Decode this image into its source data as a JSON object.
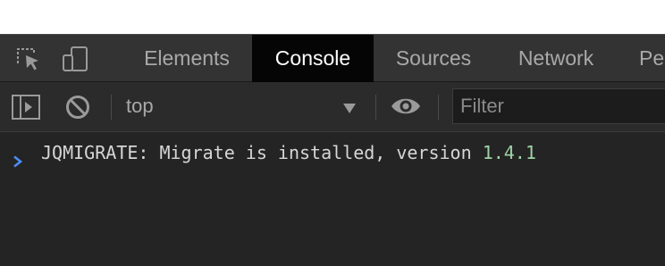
{
  "devtools": {
    "tabs": [
      {
        "label": "Elements",
        "active": false
      },
      {
        "label": "Console",
        "active": true
      },
      {
        "label": "Sources",
        "active": false
      },
      {
        "label": "Network",
        "active": false
      },
      {
        "label": "Pe",
        "active": false
      }
    ],
    "icons": {
      "inspect": "inspect-element-icon",
      "device": "device-toolbar-icon",
      "sidebar": "show-console-sidebar-icon",
      "clear": "clear-console-icon",
      "dropdown": "chevron-down-icon",
      "eye": "live-expression-eye-icon",
      "prompt": "chevron-right-icon"
    }
  },
  "toolbar": {
    "context": "top",
    "filter_placeholder": "Filter",
    "filter_value": ""
  },
  "console": {
    "messages": [
      {
        "text": "JQMIGRATE: Migrate is installed, version ",
        "version": "1.4.1"
      }
    ]
  },
  "colors": {
    "panel_bg": "#242424",
    "tabbar_bg": "#333333",
    "active_tab_bg": "#050505",
    "version_color": "#9ed4a6",
    "prompt_color": "#4c8df6"
  }
}
